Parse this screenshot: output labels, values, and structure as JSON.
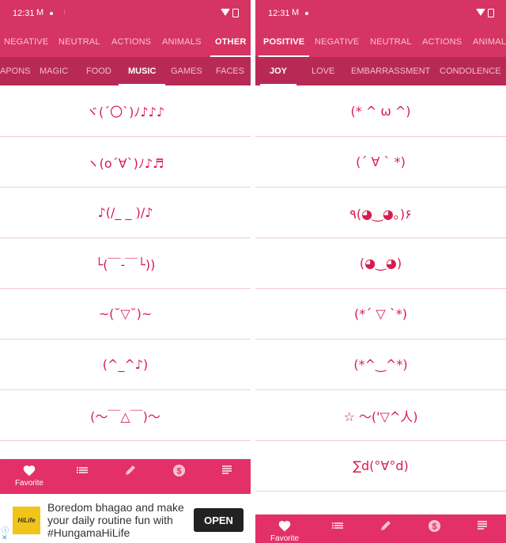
{
  "colors": {
    "primary": "#d63463",
    "secondary_bar": "#b82a55",
    "kaomoji": "#d81b50",
    "divider": "#f5c9d6",
    "bottom_nav": "#e33068"
  },
  "left": {
    "status": {
      "time": "12:31",
      "gmail_icon": "M",
      "download_icon": "↓"
    },
    "category_tabs": [
      {
        "label": "NEGATIVE",
        "active": false
      },
      {
        "label": "NEUTRAL",
        "active": false
      },
      {
        "label": "ACTIONS",
        "active": false
      },
      {
        "label": "ANIMALS",
        "active": false
      },
      {
        "label": "OTHER",
        "active": true
      }
    ],
    "sub_tabs": [
      {
        "label": "APONS",
        "active": false
      },
      {
        "label": "MAGIC",
        "active": false
      },
      {
        "label": "FOOD",
        "active": false
      },
      {
        "label": "MUSIC",
        "active": true
      },
      {
        "label": "GAMES",
        "active": false
      },
      {
        "label": "FACES",
        "active": false
      }
    ],
    "kaomoji": [
      "ヾ(´〇`)ﾉ♪♪♪",
      "ヽ(o´∀`)ﾉ♪♬",
      "♪(/_ _ )/♪",
      "└(￣-￣└))",
      "~(˘▽˘)~",
      "(^_^♪)",
      "(〜￣△￣)〜"
    ],
    "bottom_nav": [
      {
        "icon": "heart-icon",
        "label": "Favorite",
        "active": true
      },
      {
        "icon": "list-icon",
        "label": "",
        "active": false
      },
      {
        "icon": "pencil-icon",
        "label": "",
        "active": false
      },
      {
        "icon": "dollar-icon",
        "label": "",
        "active": false
      },
      {
        "icon": "text-lines-icon",
        "label": "",
        "active": false
      }
    ],
    "ad": {
      "logo_text": "HiLife",
      "text": "Boredom bhagao and make your daily routine fun with #HungamaHiLife",
      "button": "OPEN",
      "info_icon": "ⓘ",
      "close_icon": "✕"
    }
  },
  "right": {
    "status": {
      "time": "12:31",
      "gmail_icon": "M"
    },
    "category_tabs": [
      {
        "label": "POSITIVE",
        "active": true
      },
      {
        "label": "NEGATIVE",
        "active": false
      },
      {
        "label": "NEUTRAL",
        "active": false
      },
      {
        "label": "ACTIONS",
        "active": false
      },
      {
        "label": "ANIMALS",
        "active": false
      }
    ],
    "sub_tabs": [
      {
        "label": "JOY",
        "active": true
      },
      {
        "label": "LOVE",
        "active": false
      },
      {
        "label": "EMBARRASSMENT",
        "active": false
      },
      {
        "label": "CONDOLENCE",
        "active": false
      }
    ],
    "kaomoji": [
      "(* ^ ω ^)",
      "(´ ∀ ` *)",
      "٩(◕‿◕｡)۶",
      "(◕‿◕)",
      "(*´ ▽ `*)",
      "(*^‿^*)",
      "☆ ～('▽^人)",
      "∑d(°∀°d)"
    ],
    "bottom_nav": [
      {
        "icon": "heart-icon",
        "label": "Favorite",
        "active": true
      },
      {
        "icon": "list-icon",
        "label": "",
        "active": false
      },
      {
        "icon": "pencil-icon",
        "label": "",
        "active": false
      },
      {
        "icon": "dollar-icon",
        "label": "",
        "active": false
      },
      {
        "icon": "text-lines-icon",
        "label": "",
        "active": false
      }
    ]
  }
}
